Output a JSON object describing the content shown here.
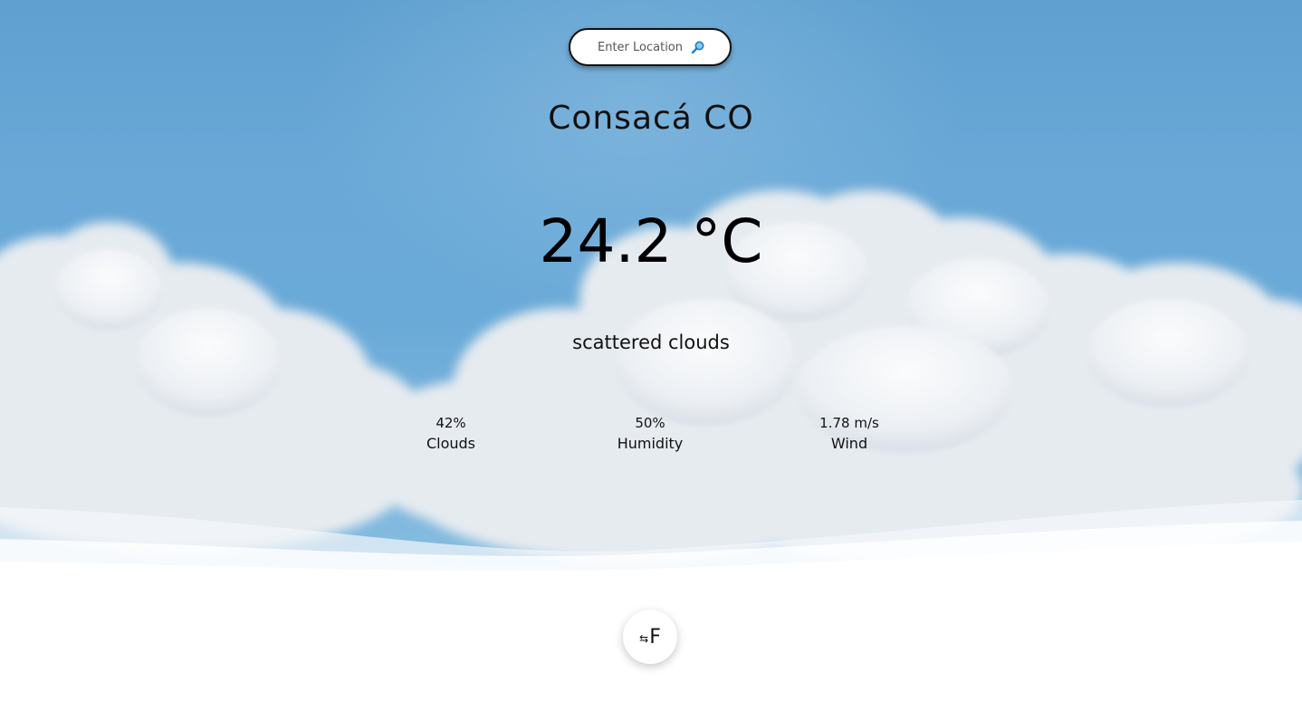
{
  "search": {
    "placeholder": "Enter Location",
    "icon": "magnifier-icon"
  },
  "location": {
    "city": "Consacá CO"
  },
  "weather": {
    "temperature": "24.2 °C",
    "description": "scattered clouds"
  },
  "stats": [
    {
      "value": "42%",
      "label": "Clouds"
    },
    {
      "value": "50%",
      "label": "Humidity"
    },
    {
      "value": "1.78 m/s",
      "label": "Wind"
    }
  ],
  "unit_toggle": {
    "icon": "swap-arrows-icon",
    "label": "F"
  },
  "colors": {
    "sky": "#69a8d7",
    "cloud": "#f2f4f7",
    "text": "#111111",
    "search_icon": "#1e7fd0"
  }
}
